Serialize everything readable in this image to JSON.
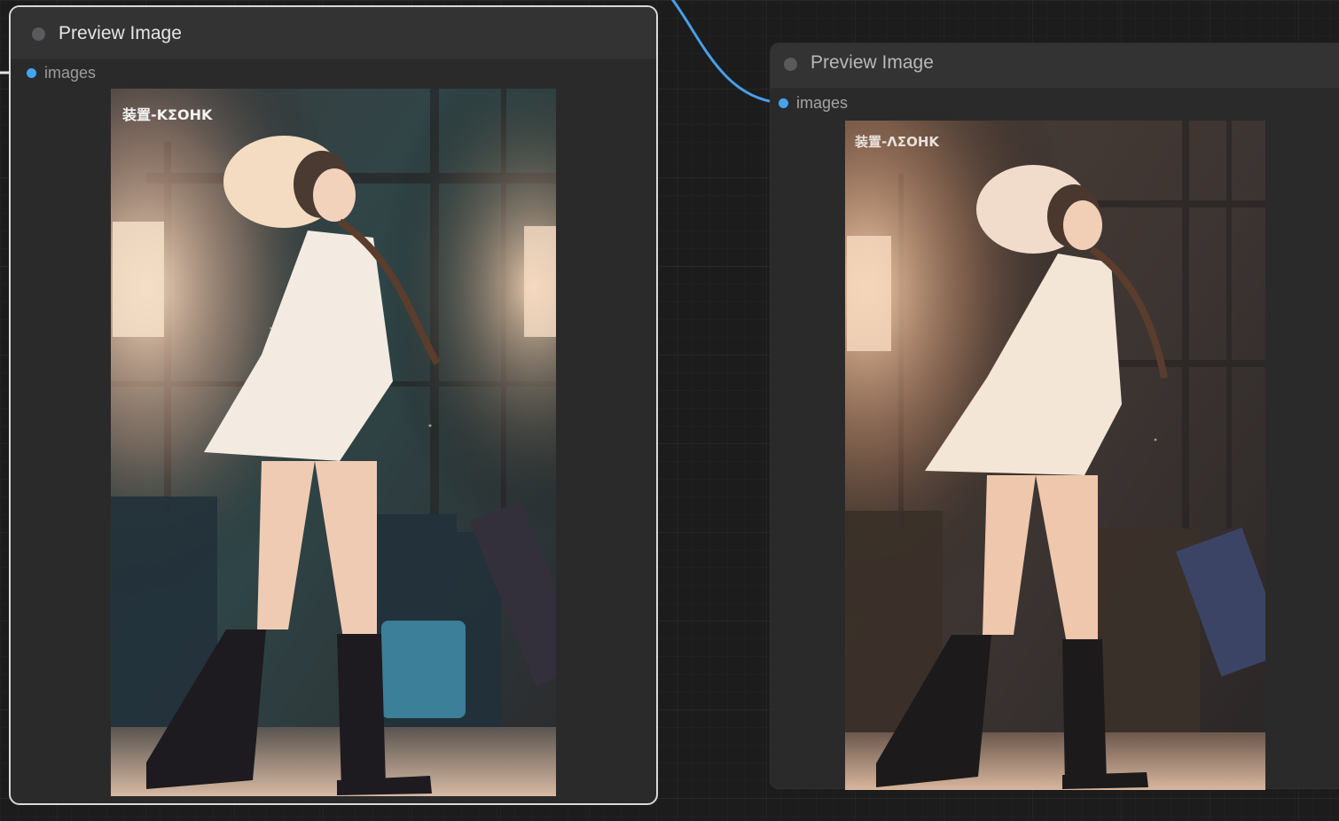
{
  "nodes": [
    {
      "title": "Preview Image",
      "input_label": "images",
      "image_caption": "装置-ΚΣΟΗΚ",
      "selected": true
    },
    {
      "title": "Preview Image",
      "input_label": "images",
      "image_caption": "装置-ΛΣΟΗΚ",
      "selected": false
    }
  ],
  "colors": {
    "link": "#4a9fe8",
    "slot": "#45a4ee",
    "selection_outline": "#d9d9d9",
    "node_body": "#2a2a2b",
    "node_header": "#333334"
  },
  "icons": {
    "collapse": "collapse-dot-icon",
    "input_slot": "input-slot-dot-icon"
  }
}
